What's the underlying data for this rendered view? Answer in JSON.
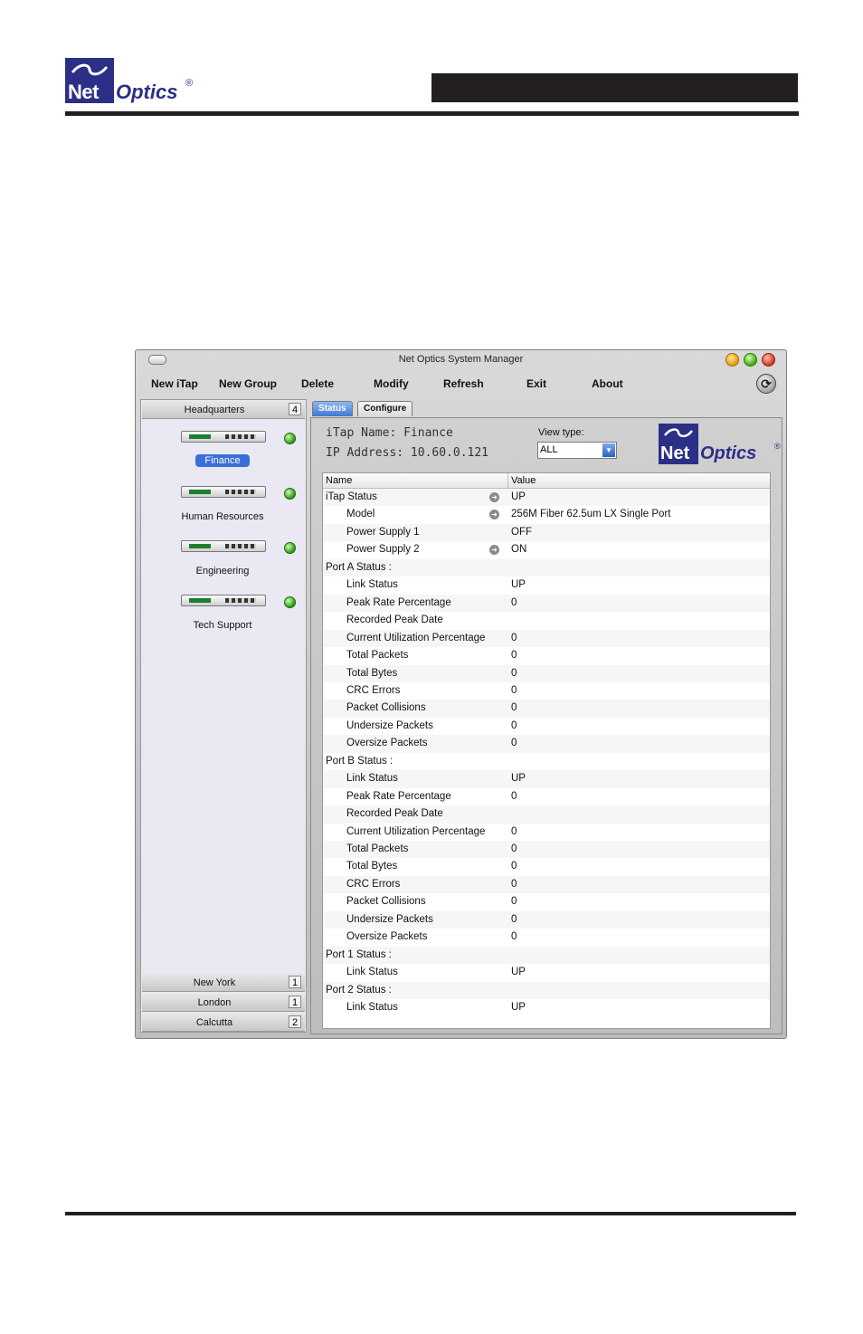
{
  "brand": {
    "net": "Net",
    "optics": "Optics",
    "reg": "®"
  },
  "window": {
    "title": "Net Optics System Manager"
  },
  "menu": [
    {
      "label": "New iTap"
    },
    {
      "label": "New Group"
    },
    {
      "label": "Delete"
    },
    {
      "label": "Modify"
    },
    {
      "label": "Refresh"
    },
    {
      "label": "Exit"
    },
    {
      "label": "About"
    }
  ],
  "groups": {
    "top": {
      "name": "Headquarters",
      "count": "4"
    },
    "bottom": [
      {
        "name": "New York",
        "count": "1"
      },
      {
        "name": "London",
        "count": "1"
      },
      {
        "name": "Calcutta",
        "count": "2"
      }
    ]
  },
  "devices": [
    {
      "name": "Finance",
      "selected": true
    },
    {
      "name": "Human Resources"
    },
    {
      "name": "Engineering"
    },
    {
      "name": "Tech Support"
    }
  ],
  "tabs": {
    "status": "Status",
    "configure": "Configure"
  },
  "detail": {
    "itap_name": "iTap Name: Finance",
    "ip_address": "IP Address: 10.60.0.121",
    "view_type_label": "View type:",
    "view_type_value": "ALL"
  },
  "table": {
    "col_name": "Name",
    "col_value": "Value",
    "rows": [
      {
        "name": "iTap Status",
        "value": "UP",
        "indent": 0,
        "arrow": true
      },
      {
        "name": "Model",
        "value": "256M Fiber 62.5um LX Single Port",
        "indent": 1,
        "arrow": true
      },
      {
        "name": "Power Supply 1",
        "value": "OFF",
        "indent": 1,
        "arrow": false
      },
      {
        "name": "Power Supply 2",
        "value": "ON",
        "indent": 1,
        "arrow": true
      },
      {
        "name": "Port A Status :",
        "value": "",
        "indent": 0,
        "arrow": false
      },
      {
        "name": "Link Status",
        "value": "UP",
        "indent": 1,
        "arrow": false
      },
      {
        "name": "Peak Rate Percentage",
        "value": "0",
        "indent": 1,
        "arrow": false
      },
      {
        "name": "Recorded Peak Date",
        "value": "",
        "indent": 1,
        "arrow": false
      },
      {
        "name": "Current Utilization Percentage",
        "value": "0",
        "indent": 1,
        "arrow": false
      },
      {
        "name": "Total Packets",
        "value": "0",
        "indent": 1,
        "arrow": false
      },
      {
        "name": "Total Bytes",
        "value": "0",
        "indent": 1,
        "arrow": false
      },
      {
        "name": "CRC Errors",
        "value": "0",
        "indent": 1,
        "arrow": false
      },
      {
        "name": "Packet Collisions",
        "value": "0",
        "indent": 1,
        "arrow": false
      },
      {
        "name": "Undersize Packets",
        "value": "0",
        "indent": 1,
        "arrow": false
      },
      {
        "name": "Oversize Packets",
        "value": "0",
        "indent": 1,
        "arrow": false
      },
      {
        "name": "Port B Status :",
        "value": "",
        "indent": 0,
        "arrow": false
      },
      {
        "name": "Link Status",
        "value": "UP",
        "indent": 1,
        "arrow": false
      },
      {
        "name": "Peak Rate Percentage",
        "value": "0",
        "indent": 1,
        "arrow": false
      },
      {
        "name": "Recorded Peak Date",
        "value": "",
        "indent": 1,
        "arrow": false
      },
      {
        "name": "Current Utilization Percentage",
        "value": "0",
        "indent": 1,
        "arrow": false
      },
      {
        "name": "Total Packets",
        "value": "0",
        "indent": 1,
        "arrow": false
      },
      {
        "name": "Total Bytes",
        "value": "0",
        "indent": 1,
        "arrow": false
      },
      {
        "name": "CRC Errors",
        "value": "0",
        "indent": 1,
        "arrow": false
      },
      {
        "name": "Packet Collisions",
        "value": "0",
        "indent": 1,
        "arrow": false
      },
      {
        "name": "Undersize Packets",
        "value": "0",
        "indent": 1,
        "arrow": false
      },
      {
        "name": "Oversize Packets",
        "value": "0",
        "indent": 1,
        "arrow": false
      },
      {
        "name": "Port 1 Status :",
        "value": "",
        "indent": 0,
        "arrow": false
      },
      {
        "name": "Link Status",
        "value": "UP",
        "indent": 1,
        "arrow": false
      },
      {
        "name": "Port 2 Status :",
        "value": "",
        "indent": 0,
        "arrow": false
      },
      {
        "name": "Link Status",
        "value": "UP",
        "indent": 1,
        "arrow": false
      }
    ]
  },
  "icons": {
    "sync": "sync-icon",
    "row_arrow": "arrow-right-circle-icon",
    "status_led": "green-led-icon"
  },
  "colors": {
    "brand": "#2b2f86",
    "selection": "#3b6ed8",
    "led": "#2a9a10",
    "header_bar": "#231f20"
  }
}
